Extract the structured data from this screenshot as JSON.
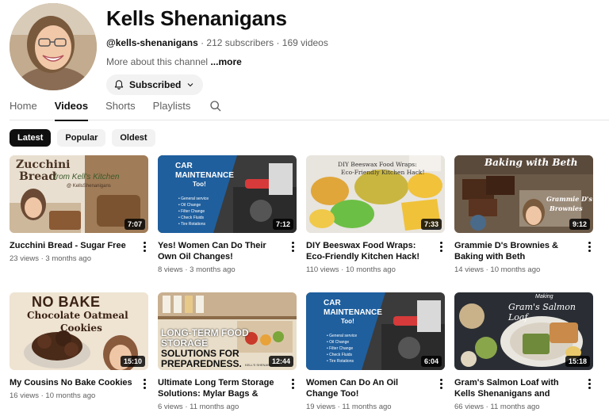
{
  "channel": {
    "name": "Kells Shenanigans",
    "handle": "@kells-shenanigans",
    "stats": "· 212 subscribers · 169 videos",
    "about": "More about this channel",
    "more": "...more",
    "subscribed_label": "Subscribed"
  },
  "tabs": [
    {
      "label": "Home"
    },
    {
      "label": "Videos"
    },
    {
      "label": "Shorts"
    },
    {
      "label": "Playlists"
    }
  ],
  "chips": [
    {
      "label": "Latest"
    },
    {
      "label": "Popular"
    },
    {
      "label": "Oldest"
    }
  ],
  "videos": [
    {
      "title": "Zucchini Bread - Sugar Free",
      "views": "23 views",
      "age": "3 months ago",
      "duration": "7:07",
      "thumb_text": [
        "Zucchini",
        "Bread",
        "from Kell's Kitchen",
        "@ KellsShenanigans"
      ]
    },
    {
      "title": "Yes! Women Can Do Their Own Oil Changes!",
      "views": "8 views",
      "age": "3 months ago",
      "duration": "7:12",
      "thumb_text": [
        "CAR",
        "MAINTENANCE",
        "Too!",
        "• General service",
        "• Oil Change",
        "• Filter Change",
        "• Check Fluids",
        "• Tire Rotations"
      ]
    },
    {
      "title": "DIY Beeswax Food Wraps: Eco-Friendly Kitchen Hack!",
      "views": "110 views",
      "age": "10 months ago",
      "duration": "7:33",
      "thumb_text": [
        "DIY Beeswax Food Wraps:",
        "Eco-Friendly Kitchen Hack!"
      ]
    },
    {
      "title": "Grammie D's Brownies & Baking with Beth",
      "views": "14 views",
      "age": "10 months ago",
      "duration": "9:12",
      "thumb_text": [
        "Baking with Beth",
        "Grammie D's",
        "Brownies"
      ]
    },
    {
      "title": "My Cousins No Bake Cookies",
      "views": "16 views",
      "age": "10 months ago",
      "duration": "15:10",
      "thumb_text": [
        "NO BAKE",
        "Chocolate Oatmeal",
        "Cookies"
      ]
    },
    {
      "title": "Ultimate Long Term Storage Solutions: Mylar Bags & Kell's...",
      "views": "6 views",
      "age": "11 months ago",
      "duration": "12:44",
      "thumb_text": [
        "LONG-TERM FOOD",
        "STORAGE",
        "SOLUTIONS FOR",
        "PREPAREDNESS.",
        "KELL'S SHENANIGANS"
      ]
    },
    {
      "title": "Women Can Do An Oil Change Too!",
      "views": "19 views",
      "age": "11 months ago",
      "duration": "6:04",
      "thumb_text": [
        "CAR",
        "MAINTENANCE",
        "Too!",
        "• General service",
        "• Oil Change",
        "• Filter Change",
        "• Check Fluids",
        "• Tire Rotations"
      ]
    },
    {
      "title": "Gram's Salmon Loaf with Kells Shenanigans and Baking with Beth",
      "views": "66 views",
      "age": "11 months ago",
      "duration": "15:18",
      "thumb_text": [
        "Making",
        "Gram's Salmon Loaf"
      ]
    }
  ],
  "colors": {
    "active_chip_bg": "#0f0f0f",
    "chip_bg": "#f2f2f2",
    "meta_text": "#606060",
    "car_blue": "#1f5f9e"
  },
  "icons": {
    "subscribe_bell": "bell-icon",
    "subscribe_dropdown": "chevron-down-icon",
    "tab_search": "search-icon",
    "video_menu": "more-vert-icon"
  }
}
